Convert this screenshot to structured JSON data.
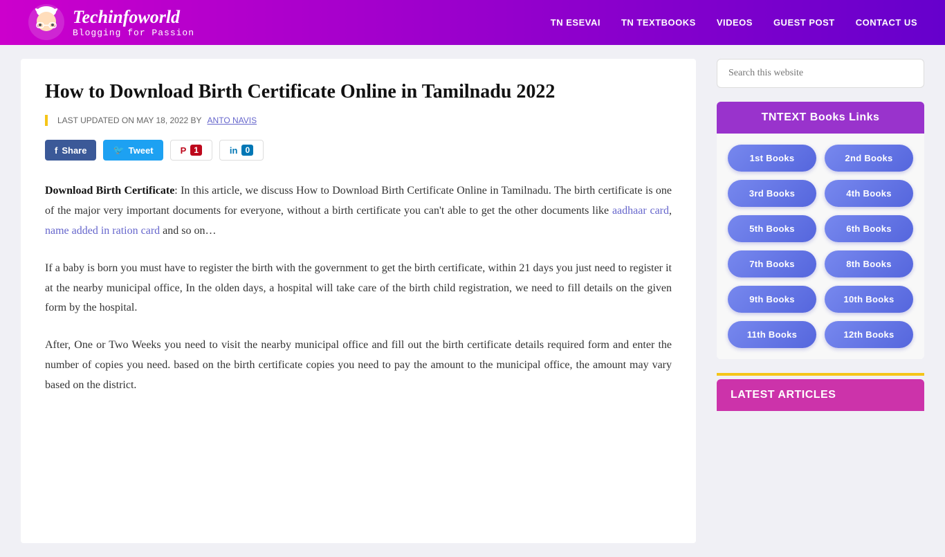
{
  "header": {
    "logo_title": "Techinfoworld",
    "logo_tagline": "Blogging for Passion",
    "nav_items": [
      {
        "label": "TN ESEVAI",
        "id": "tn-esevai"
      },
      {
        "label": "TN TEXTBOOKS",
        "id": "tn-textbooks"
      },
      {
        "label": "VIDEOS",
        "id": "videos"
      },
      {
        "label": "GUEST POST",
        "id": "guest-post"
      },
      {
        "label": "CONTACT US",
        "id": "contact-us"
      }
    ]
  },
  "article": {
    "title": "How to Download Birth Certificate Online in Tamilnadu 2022",
    "meta_prefix": "LAST UPDATED ON MAY 18, 2022 BY",
    "meta_author": "ANTO NAVIS",
    "social": {
      "share_label": "Share",
      "tweet_label": "Tweet",
      "pinterest_label": "1",
      "linkedin_label": "0"
    },
    "paragraphs": [
      {
        "id": "p1",
        "text_before_strong": "",
        "strong_text": "Download Birth Certificate",
        "text_after": ": In this article, we discuss How to Download Birth Certificate Online in Tamilnadu. The birth certificate is one of the major very important documents for everyone, without a birth certificate you can't able to get the other documents like ",
        "link1_text": "aadhaar card",
        "link1_href": "#",
        "text_between": ", ",
        "link2_text": "name added in ration card",
        "link2_href": "#",
        "text_end": " and so on…"
      },
      {
        "id": "p2",
        "text": "If a baby is born you must have to register the birth with the government to get the birth certificate, within 21 days you just need to register it at the nearby municipal office, In the olden days, a hospital will take care of the birth child registration, we need to fill details on the given form by the hospital."
      },
      {
        "id": "p3",
        "text": "After, One or Two Weeks you need to visit the nearby municipal office and fill out the birth certificate details required form and enter the number of copies you need. based on the birth certificate copies you need to pay the amount to the municipal office, the amount may vary based on the district."
      }
    ]
  },
  "sidebar": {
    "search_placeholder": "Search this website",
    "tntext_title": "TNTEXT Books Links",
    "books": [
      {
        "label": "1st Books"
      },
      {
        "label": "2nd Books"
      },
      {
        "label": "3rd Books"
      },
      {
        "label": "4th Books"
      },
      {
        "label": "5th Books"
      },
      {
        "label": "6th Books"
      },
      {
        "label": "7th Books"
      },
      {
        "label": "8th Books"
      },
      {
        "label": "9th Books"
      },
      {
        "label": "10th Books"
      },
      {
        "label": "11th Books"
      },
      {
        "label": "12th Books"
      }
    ],
    "latest_articles_title": "LATEST ARTICLES"
  }
}
